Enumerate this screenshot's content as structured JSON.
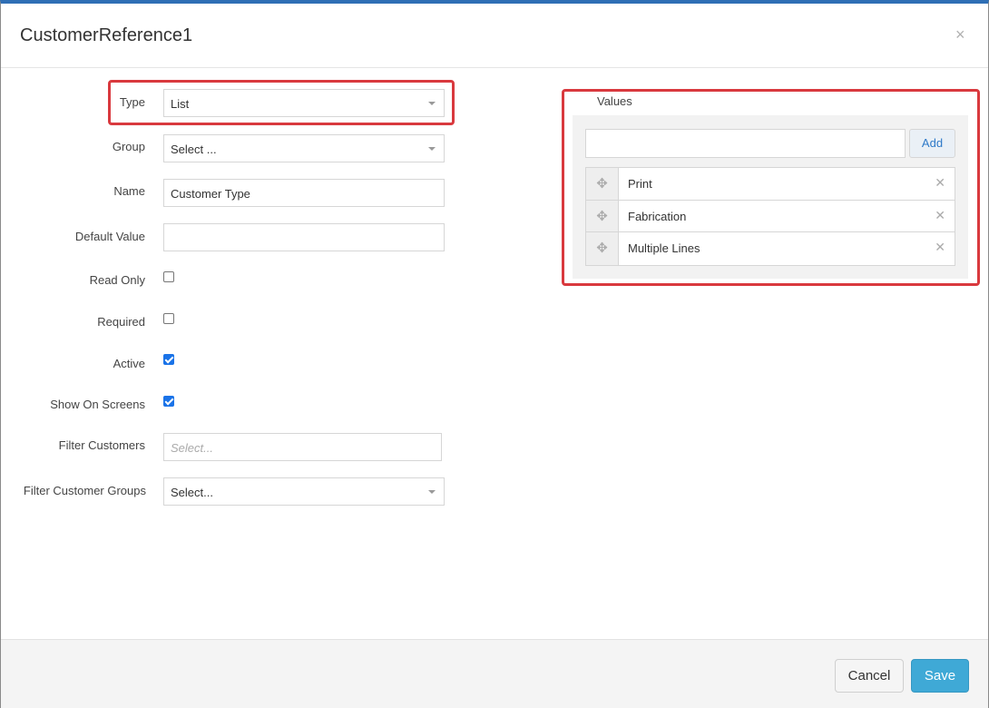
{
  "dialog": {
    "title": "CustomerReference1",
    "close_glyph": "×"
  },
  "form": {
    "type": {
      "label": "Type",
      "value": "List"
    },
    "group": {
      "label": "Group",
      "value": "Select ..."
    },
    "name": {
      "label": "Name",
      "value": "Customer Type"
    },
    "default_value": {
      "label": "Default Value",
      "value": ""
    },
    "read_only": {
      "label": "Read Only",
      "checked": false
    },
    "required": {
      "label": "Required",
      "checked": false
    },
    "active": {
      "label": "Active",
      "checked": true
    },
    "show_on_screens": {
      "label": "Show On Screens",
      "checked": true
    },
    "filter_customers": {
      "label": "Filter Customers",
      "placeholder": "Select..."
    },
    "filter_customer_groups": {
      "label": "Filter Customer Groups",
      "value": "Select..."
    }
  },
  "values": {
    "title": "Values",
    "input_value": "",
    "add_label": "Add",
    "drag_glyph": "✥",
    "remove_glyph": "✕",
    "items": [
      {
        "label": "Print"
      },
      {
        "label": "Fabrication"
      },
      {
        "label": "Multiple Lines"
      }
    ]
  },
  "footer": {
    "cancel_label": "Cancel",
    "save_label": "Save"
  },
  "colors": {
    "highlight": "#d9393e",
    "primary": "#3fa9d6",
    "checkbox_checked": "#1a73e8"
  }
}
